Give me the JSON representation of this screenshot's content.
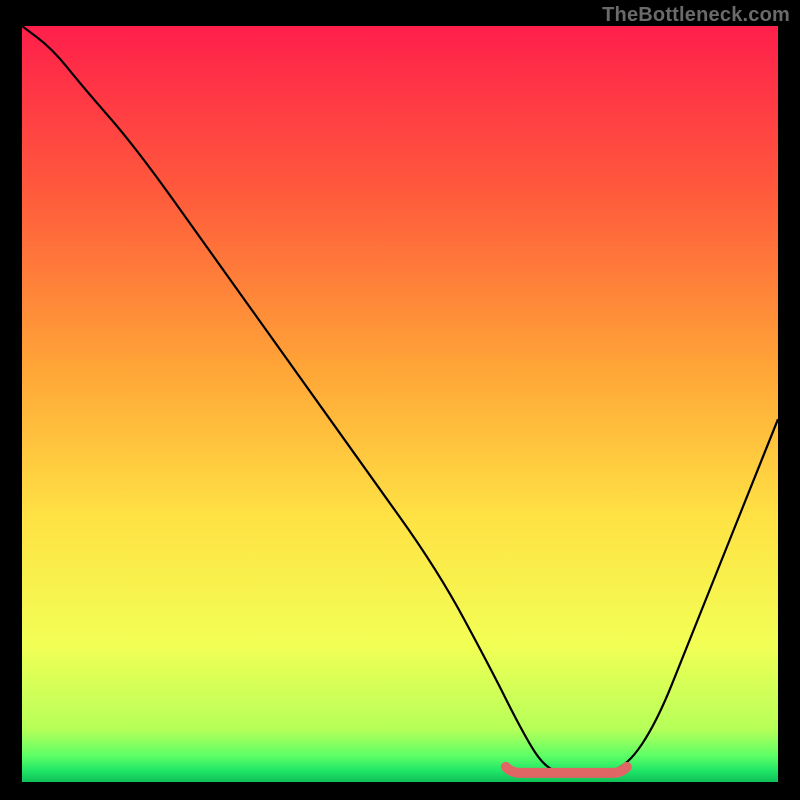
{
  "attribution": "TheBottleneck.com",
  "chart_data": {
    "type": "line",
    "title": "",
    "xlabel": "",
    "ylabel": "",
    "xlim": [
      0,
      100
    ],
    "ylim": [
      0,
      100
    ],
    "x": [
      0,
      4,
      8,
      15,
      25,
      35,
      45,
      55,
      62,
      66,
      69,
      72,
      76,
      80,
      84,
      88,
      92,
      96,
      100
    ],
    "values": [
      100,
      97,
      92,
      84,
      70,
      56,
      42,
      28,
      15,
      7,
      2,
      1,
      1,
      2,
      8,
      18,
      28,
      38,
      48
    ],
    "sweet_spot": {
      "x_start": 64,
      "x_end": 80,
      "y": 1.2
    },
    "gradient_stops": [
      {
        "offset": 0.0,
        "color": "#ff1f4b"
      },
      {
        "offset": 0.22,
        "color": "#ff5a3c"
      },
      {
        "offset": 0.45,
        "color": "#ffa437"
      },
      {
        "offset": 0.65,
        "color": "#ffe244"
      },
      {
        "offset": 0.82,
        "color": "#f2ff55"
      },
      {
        "offset": 0.93,
        "color": "#b6ff59"
      },
      {
        "offset": 0.965,
        "color": "#5eff66"
      },
      {
        "offset": 0.985,
        "color": "#20e667"
      },
      {
        "offset": 1.0,
        "color": "#0fbf58"
      }
    ]
  }
}
